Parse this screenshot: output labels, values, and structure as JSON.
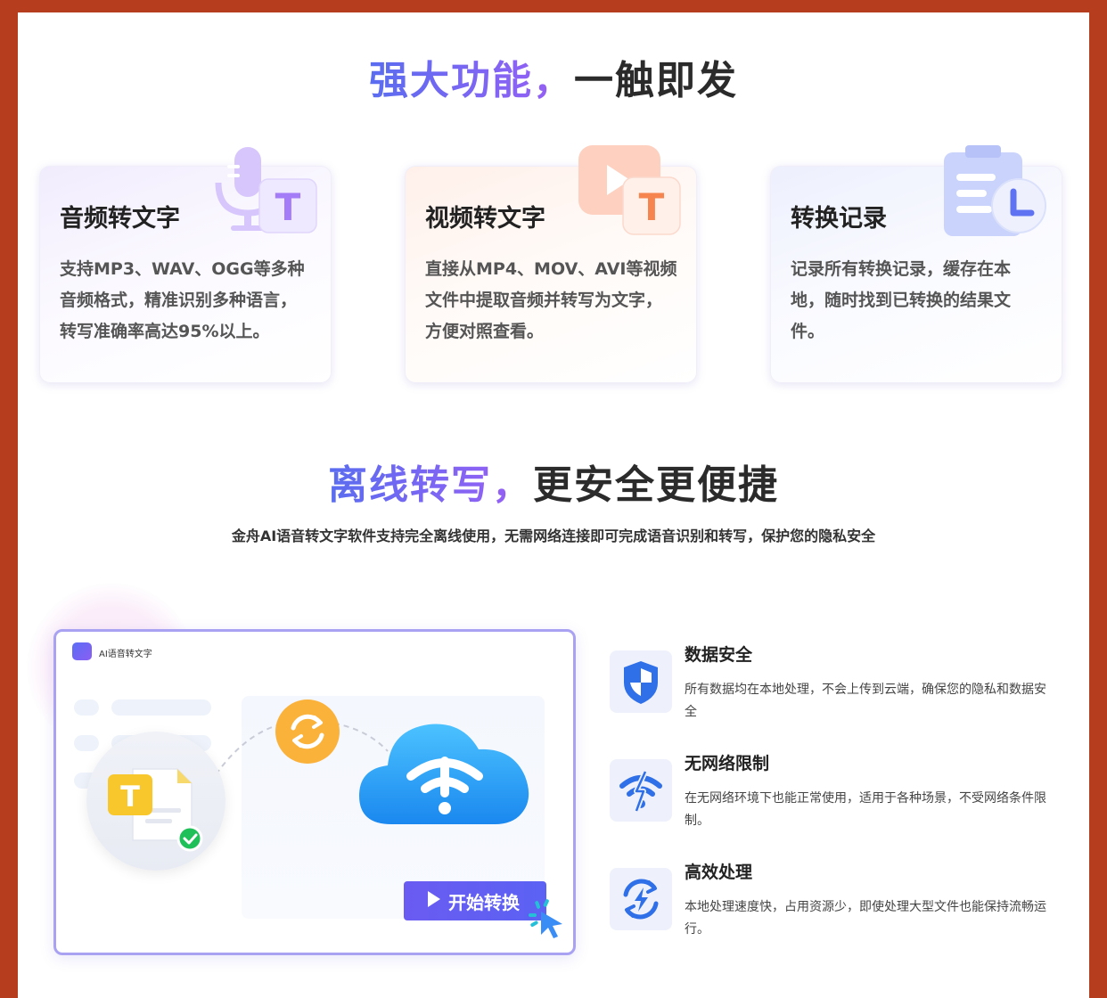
{
  "section1": {
    "title_accent": "强大功能，",
    "title_rest": "一触即发"
  },
  "cards": [
    {
      "title": "音频转文字",
      "description": "支持MP3、WAV、OGG等多种音频格式，精准识别多种语言，转写准确率高达95%以上。",
      "icon": "microphone-text-icon",
      "icon_letter": "T"
    },
    {
      "title": "视频转文字",
      "description": "直接从MP4、MOV、AVI等视频文件中提取音频并转写为文字，方便对照查看。",
      "icon": "video-text-icon",
      "icon_letter": "T"
    },
    {
      "title": "转换记录",
      "description": "记录所有转换记录，缓存在本地，随时找到已转换的结果文件。",
      "icon": "clipboard-clock-icon"
    }
  ],
  "section2": {
    "title_accent": "离线转写，",
    "title_rest": "更安全更便捷",
    "subtitle": "金舟AI语音转文字软件支持完全离线使用，无需网络连接即可完成语音识别和转写，保护您的隐私安全"
  },
  "demo_window": {
    "app_title": "AI语音转文字",
    "start_button": "开始转换",
    "doc_letter": "T"
  },
  "features": [
    {
      "title": "数据安全",
      "description": "所有数据均在本地处理，不会上传到云端，确保您的隐私和数据安全",
      "icon": "shield-icon"
    },
    {
      "title": "无网络限制",
      "description": "在无网络环境下也能正常使用，适用于各种场景，不受网络条件限制。",
      "icon": "no-wifi-icon"
    },
    {
      "title": "高效处理",
      "description": "本地处理速度快，占用资源少，即使处理大型文件也能保持流畅运行。",
      "icon": "lightning-refresh-icon"
    }
  ],
  "colors": {
    "background_border": "#b73d1f",
    "accent_start": "#5a6df0",
    "accent_end": "#9b5ff5",
    "button": "#6a5bf2"
  }
}
